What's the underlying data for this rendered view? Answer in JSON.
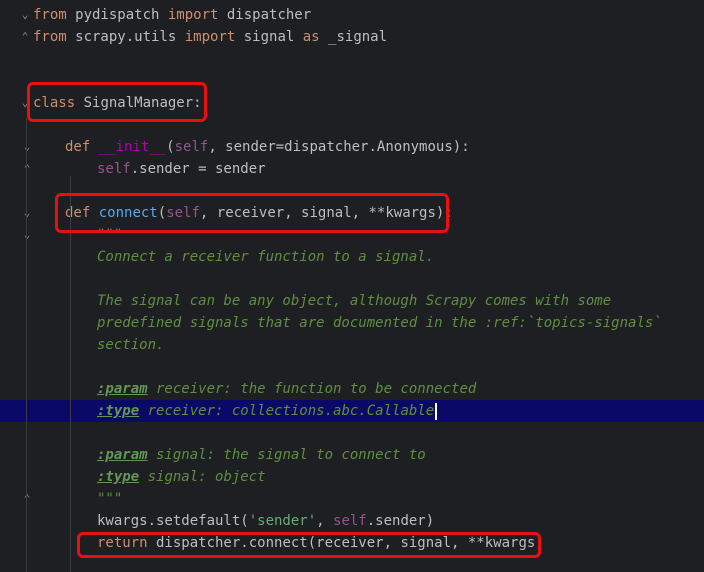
{
  "editor": {
    "lines": [
      {
        "n": "l1",
        "fold": "⌄",
        "indent": 0,
        "tokens": [
          [
            "kw",
            "from"
          ],
          [
            "plain",
            " pydispatch "
          ],
          [
            "kw",
            "import"
          ],
          [
            "plain",
            " dispatcher"
          ]
        ]
      },
      {
        "n": "l2",
        "fold": "⌃",
        "indent": 0,
        "tokens": [
          [
            "kw",
            "from"
          ],
          [
            "plain",
            " scrapy.utils "
          ],
          [
            "kw",
            "import"
          ],
          [
            "plain",
            " signal "
          ],
          [
            "kw",
            "as"
          ],
          [
            "plain",
            " _signal"
          ]
        ]
      },
      {
        "n": "l3",
        "fold": "",
        "indent": 0,
        "tokens": []
      },
      {
        "n": "l4",
        "fold": "",
        "indent": 0,
        "tokens": []
      },
      {
        "n": "l5",
        "fold": "⌄",
        "indent": 0,
        "tokens": [
          [
            "kw",
            "class"
          ],
          [
            "plain",
            " SignalManager:"
          ]
        ]
      },
      {
        "n": "l6",
        "fold": "",
        "indent": 0,
        "tokens": []
      },
      {
        "n": "l7",
        "fold": "⌄",
        "indent": 1,
        "tokens": [
          [
            "kw",
            "def"
          ],
          [
            "plain",
            " "
          ],
          [
            "magic",
            "__init__"
          ],
          [
            "plain",
            "("
          ],
          [
            "self",
            "self"
          ],
          [
            "plain",
            ", sender=dispatcher.Anonymous):"
          ]
        ]
      },
      {
        "n": "l8",
        "fold": "⌃",
        "indent": 2,
        "tokens": [
          [
            "self",
            "self"
          ],
          [
            "plain",
            ".sender = sender"
          ]
        ]
      },
      {
        "n": "l9",
        "fold": "",
        "indent": 0,
        "tokens": []
      },
      {
        "n": "l10",
        "fold": "⌄",
        "indent": 1,
        "tokens": [
          [
            "kw",
            "def"
          ],
          [
            "plain",
            " "
          ],
          [
            "fn",
            "connect"
          ],
          [
            "plain",
            "("
          ],
          [
            "self",
            "self"
          ],
          [
            "plain",
            ", receiver, signal, **kwargs):"
          ]
        ]
      },
      {
        "n": "l11",
        "fold": "⌄",
        "indent": 2,
        "tokens": [
          [
            "doc",
            "\"\"\""
          ]
        ]
      },
      {
        "n": "l12",
        "fold": "",
        "indent": 2,
        "tokens": [
          [
            "doc",
            "Connect a receiver function to a signal."
          ]
        ]
      },
      {
        "n": "l13",
        "fold": "",
        "indent": 0,
        "tokens": []
      },
      {
        "n": "l14",
        "fold": "",
        "indent": 2,
        "tokens": [
          [
            "doc",
            "The signal can be any object, although Scrapy comes with some"
          ]
        ]
      },
      {
        "n": "l15",
        "fold": "",
        "indent": 2,
        "tokens": [
          [
            "doc",
            "predefined signals that are documented in the :ref:`topics-signals`"
          ]
        ]
      },
      {
        "n": "l16",
        "fold": "",
        "indent": 2,
        "tokens": [
          [
            "doc",
            "section."
          ]
        ]
      },
      {
        "n": "l17",
        "fold": "",
        "indent": 0,
        "tokens": []
      },
      {
        "n": "l18",
        "fold": "",
        "indent": 2,
        "tokens": [
          [
            "tag",
            ":param"
          ],
          [
            "doc",
            " receiver: the function to be connected"
          ]
        ]
      },
      {
        "n": "l19",
        "fold": "",
        "indent": 2,
        "current": true,
        "tokens": [
          [
            "tag",
            ":type"
          ],
          [
            "doc",
            " receiver: collections.abc.Callable"
          ]
        ]
      },
      {
        "n": "l20",
        "fold": "",
        "indent": 0,
        "tokens": []
      },
      {
        "n": "l21",
        "fold": "",
        "indent": 2,
        "tokens": [
          [
            "tag",
            ":param"
          ],
          [
            "doc",
            " signal: the signal to connect to"
          ]
        ]
      },
      {
        "n": "l22",
        "fold": "",
        "indent": 2,
        "tokens": [
          [
            "tag",
            ":type"
          ],
          [
            "doc",
            " signal: object"
          ]
        ]
      },
      {
        "n": "l23",
        "fold": "⌃",
        "indent": 2,
        "tokens": [
          [
            "doc",
            "\"\"\""
          ]
        ]
      },
      {
        "n": "l24",
        "fold": "",
        "indent": 2,
        "tokens": [
          [
            "plain",
            "kwargs.setdefault("
          ],
          [
            "str",
            "'sender'"
          ],
          [
            "plain",
            ", "
          ],
          [
            "self",
            "self"
          ],
          [
            "plain",
            ".sender)"
          ]
        ]
      },
      {
        "n": "l25",
        "fold": "",
        "indent": 2,
        "tokens": [
          [
            "kw",
            "return"
          ],
          [
            "plain",
            " dispatcher.connect(receiver, signal, **kwargs)"
          ]
        ]
      }
    ]
  },
  "colors": {
    "background": "#1e1f22",
    "highlight_box": "#e81010",
    "current_line": "#0a0a66",
    "keyword": "#cf8e6d",
    "docstring": "#5f8f3f"
  }
}
